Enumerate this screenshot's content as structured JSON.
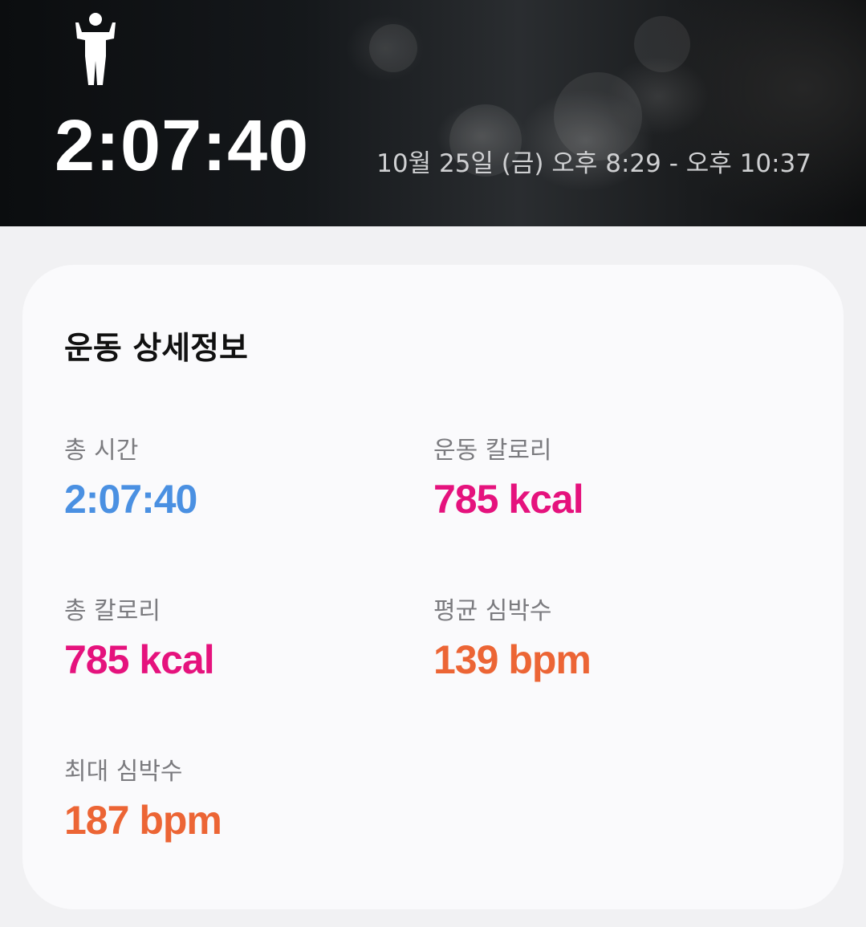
{
  "header": {
    "activity_icon": "person-flexing-icon",
    "duration": "2:07:40",
    "time_range": "10월 25일 (금) 오후 8:29 - 오후 10:37"
  },
  "details": {
    "title": "운동 상세정보",
    "stats": [
      {
        "label": "총 시간",
        "value": "2:07:40",
        "color": "#4a90e2"
      },
      {
        "label": "운동 칼로리",
        "value": "785 kcal",
        "color": "#e5127d"
      },
      {
        "label": "총 칼로리",
        "value": "785 kcal",
        "color": "#e5127d"
      },
      {
        "label": "평균 심박수",
        "value": "139 bpm",
        "color": "#ec6535"
      },
      {
        "label": "최대 심박수",
        "value": "187 bpm",
        "color": "#ec6535"
      }
    ]
  }
}
